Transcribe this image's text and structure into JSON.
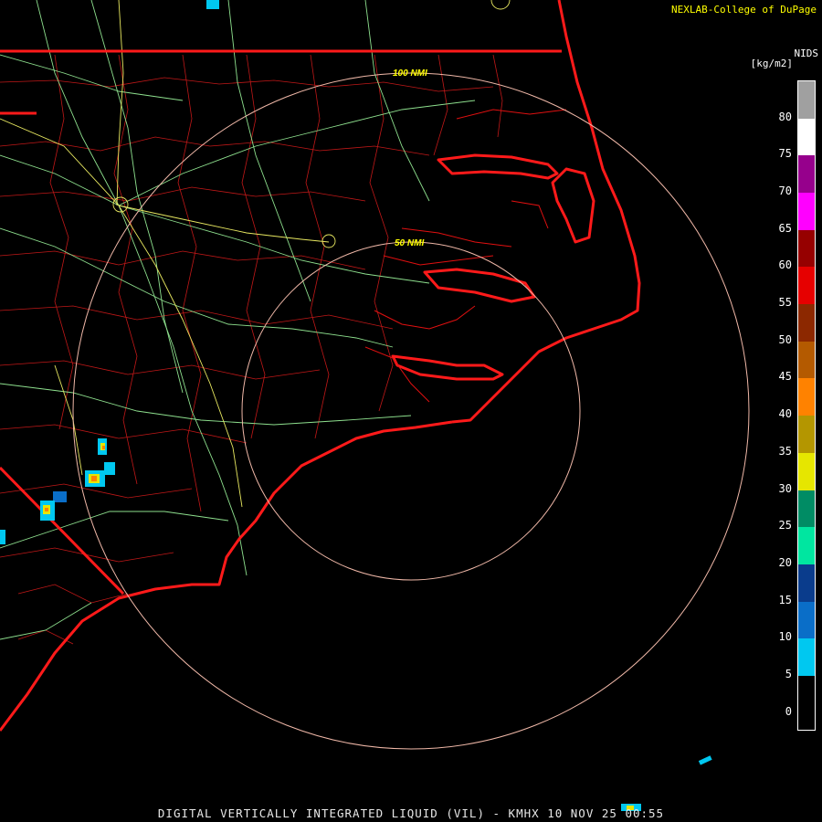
{
  "header": {
    "credit": "NEXLAB-College of DuPage",
    "product_label": "NIDS",
    "units": "[kg/m2]"
  },
  "map": {
    "range_rings": [
      {
        "label": "50 NMI",
        "nmi": 50
      },
      {
        "label": "100 NMI",
        "nmi": 100
      }
    ]
  },
  "colorbar": {
    "ticks": [
      "80",
      "75",
      "70",
      "65",
      "60",
      "55",
      "50",
      "45",
      "40",
      "35",
      "30",
      "25",
      "20",
      "15",
      "10",
      "5",
      "0"
    ],
    "stops": [
      {
        "from": 5,
        "to": 10,
        "color": "#00c8f0"
      },
      {
        "from": 10,
        "to": 15,
        "color": "#0a6ec8"
      },
      {
        "from": 15,
        "to": 20,
        "color": "#0a3c8c"
      },
      {
        "from": 20,
        "to": 25,
        "color": "#00e6a0"
      },
      {
        "from": 25,
        "to": 30,
        "color": "#008c64"
      },
      {
        "from": 30,
        "to": 35,
        "color": "#e6e600"
      },
      {
        "from": 35,
        "to": 40,
        "color": "#b49600"
      },
      {
        "from": 40,
        "to": 45,
        "color": "#ff8200"
      },
      {
        "from": 45,
        "to": 50,
        "color": "#b45a00"
      },
      {
        "from": 50,
        "to": 55,
        "color": "#8c2800"
      },
      {
        "from": 55,
        "to": 60,
        "color": "#e60000"
      },
      {
        "from": 60,
        "to": 65,
        "color": "#960000"
      },
      {
        "from": 65,
        "to": 70,
        "color": "#ff00ff"
      },
      {
        "from": 70,
        "to": 75,
        "color": "#96008c"
      },
      {
        "from": 75,
        "to": 80,
        "color": "#ffffff"
      },
      {
        "from": 80,
        "to": 85,
        "color": "#a0a0a0"
      }
    ]
  },
  "footer": {
    "caption": "DIGITAL VERTICALLY INTEGRATED LIQUID (VIL) - KMHX 10 NOV 25 00:55"
  }
}
